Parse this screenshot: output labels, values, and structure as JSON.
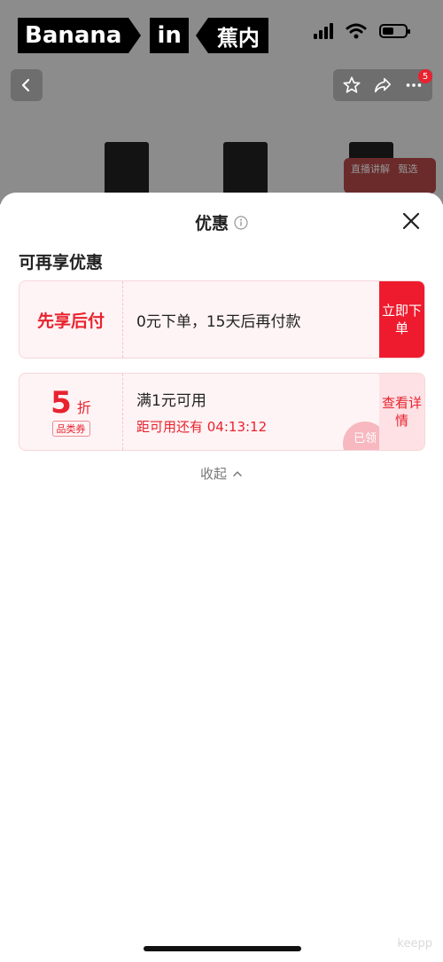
{
  "status_bar": {
    "brand_word1": "Banana",
    "brand_word2": "in",
    "brand_word3": "蕉内"
  },
  "nav": {
    "cart_badge": "5"
  },
  "live_tag": {
    "label": "直播讲解",
    "sub": "甄选"
  },
  "sheet": {
    "title": "优惠",
    "section_title": "可再享优惠",
    "pay_later": {
      "label": "先享后付",
      "description": "0元下单，15天后再付款",
      "button": "立即下单"
    },
    "coupon": {
      "value": "5",
      "unit": "折",
      "type": "品类券",
      "condition": "满1元可用",
      "countdown": "距可用还有 04:13:12",
      "button": "查看详情",
      "stamp": "已领"
    },
    "collapse_label": "收起"
  },
  "watermark": "keepp",
  "colors": {
    "accent": "#e8232f",
    "card_bg": "#fff4f5",
    "overlay": "rgba(0,0,0,0.42)"
  },
  "icons": [
    "back-icon",
    "star-icon",
    "share-icon",
    "more-icon",
    "info-icon",
    "close-icon",
    "chevron-up-icon"
  ]
}
